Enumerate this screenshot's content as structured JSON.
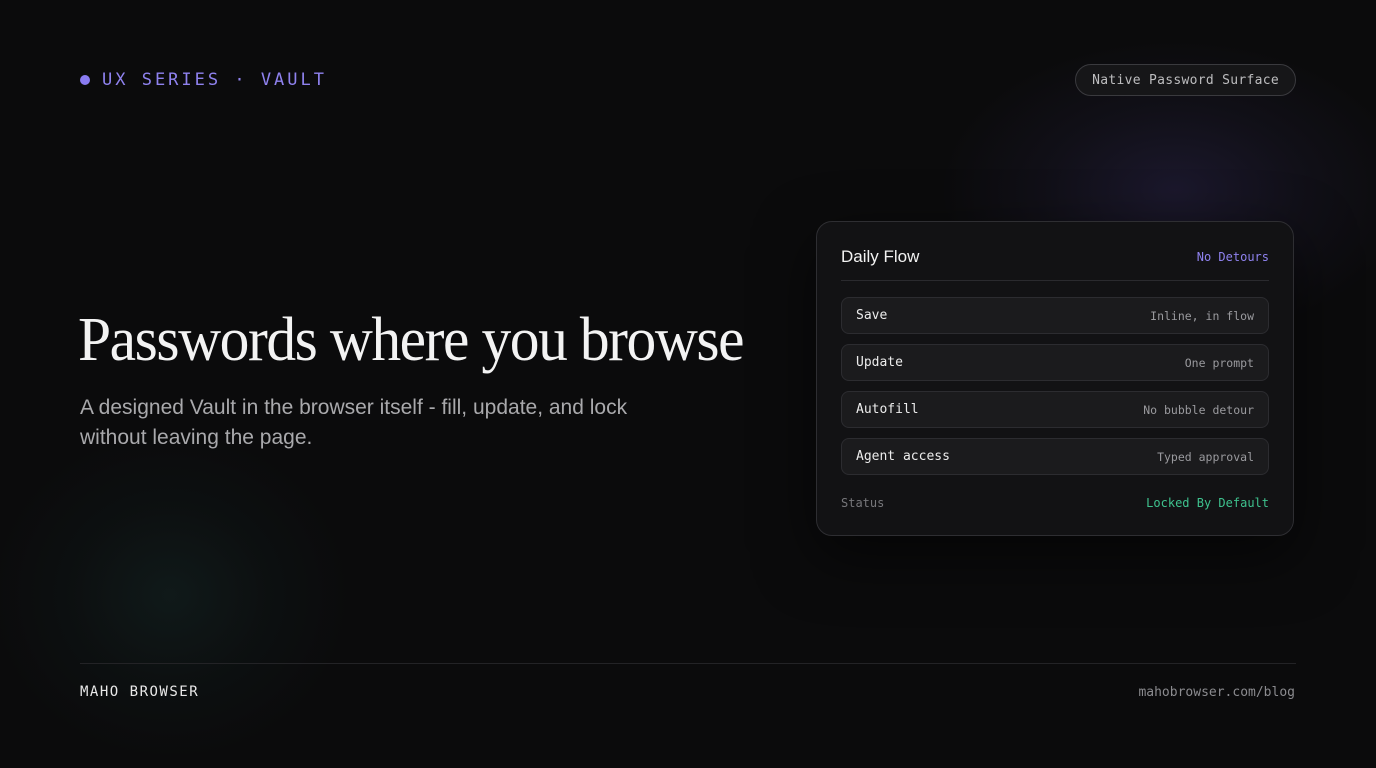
{
  "header": {
    "series_label": "UX SERIES · VAULT",
    "surface_badge": "Native Password Surface"
  },
  "hero": {
    "title": "Passwords where you browse",
    "subtitle": "A designed Vault in the browser itself - fill, update, and lock without leaving the page."
  },
  "card": {
    "title": "Daily Flow",
    "tag": "No Detours",
    "rows": [
      {
        "label": "Save",
        "value": "Inline, in flow"
      },
      {
        "label": "Update",
        "value": "One prompt"
      },
      {
        "label": "Autofill",
        "value": "No bubble detour"
      },
      {
        "label": "Agent access",
        "value": "Typed approval"
      }
    ],
    "status_label": "Status",
    "status_value": "Locked By Default"
  },
  "footer": {
    "brand": "MAHO BROWSER",
    "url": "mahobrowser.com/blog"
  },
  "colors": {
    "background": "#0b0b0c",
    "accent_purple": "#8f82ef",
    "status_green": "#3ec28e"
  }
}
